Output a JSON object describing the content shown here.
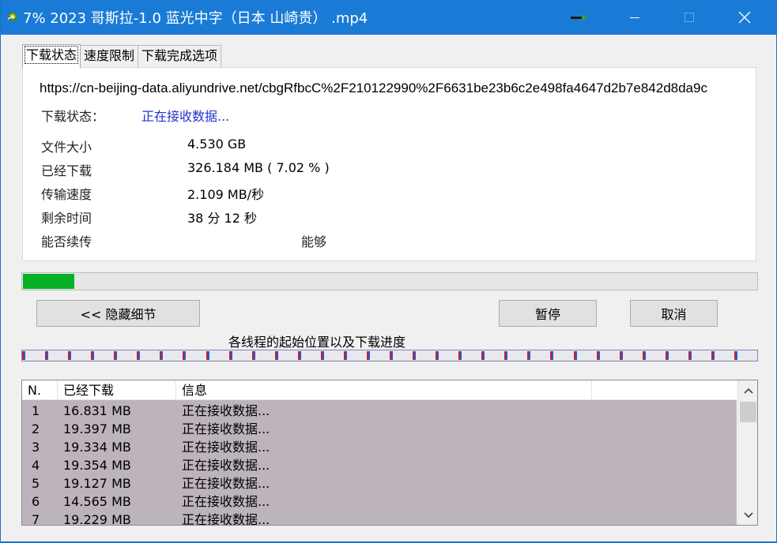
{
  "window": {
    "title": "7% 2023 哥斯拉-1.0 蓝光中字（日本 山崎贵） .mp4"
  },
  "tabs": [
    {
      "label": "下载状态",
      "active": true
    },
    {
      "label": "速度限制",
      "active": false
    },
    {
      "label": "下载完成选项",
      "active": false
    }
  ],
  "status": {
    "url": "https://cn-beijing-data.aliyundrive.net/cbgRfbcC%2F210122990%2F6631be23b6c2e498fa4647d2b7e842d8da9c",
    "state_label": "下载状态：",
    "state_value": "正在接收数据...",
    "file_size_label": "文件大小",
    "file_size_value": "4.530  GB",
    "downloaded_label": "已经下载",
    "downloaded_value": "326.184  MB  ( 7.02 % )",
    "speed_label": "传输速度",
    "speed_value": "2.109  MB/秒",
    "remaining_label": "剩余时间",
    "remaining_value": "38 分 12 秒",
    "resume_label": "能否续传",
    "resume_value": "能够"
  },
  "progress": {
    "percent": 7.02
  },
  "buttons": {
    "hide_details": "<< 隐藏细节",
    "pause": "暂停",
    "cancel": "取消"
  },
  "threads": {
    "title": "各线程的起始位置以及下载进度"
  },
  "table": {
    "headers": [
      "N.",
      "已经下载",
      "信息"
    ],
    "rows": [
      {
        "n": "1",
        "downloaded": "16.831  MB",
        "info": "正在接收数据..."
      },
      {
        "n": "2",
        "downloaded": "19.397  MB",
        "info": "正在接收数据..."
      },
      {
        "n": "3",
        "downloaded": "19.334  MB",
        "info": "正在接收数据..."
      },
      {
        "n": "4",
        "downloaded": "19.354  MB",
        "info": "正在接收数据..."
      },
      {
        "n": "5",
        "downloaded": "19.127  MB",
        "info": "正在接收数据..."
      },
      {
        "n": "6",
        "downloaded": "14.565  MB",
        "info": "正在接收数据..."
      },
      {
        "n": "7",
        "downloaded": "19.229  MB",
        "info": "正在接收数据..."
      }
    ]
  },
  "colors": {
    "titlebar": "#1a7bd6",
    "progress_fill": "#06b025",
    "row_highlight": "#bdb3bc",
    "status_text": "#2233d0"
  },
  "icons": {
    "app": "app-globe-icon",
    "title_arrow": "arrow-icon",
    "minimize": "minimize-icon",
    "maximize": "maximize-icon",
    "close": "close-icon",
    "scroll_up": "chevron-up-icon",
    "scroll_down": "chevron-down-icon"
  }
}
